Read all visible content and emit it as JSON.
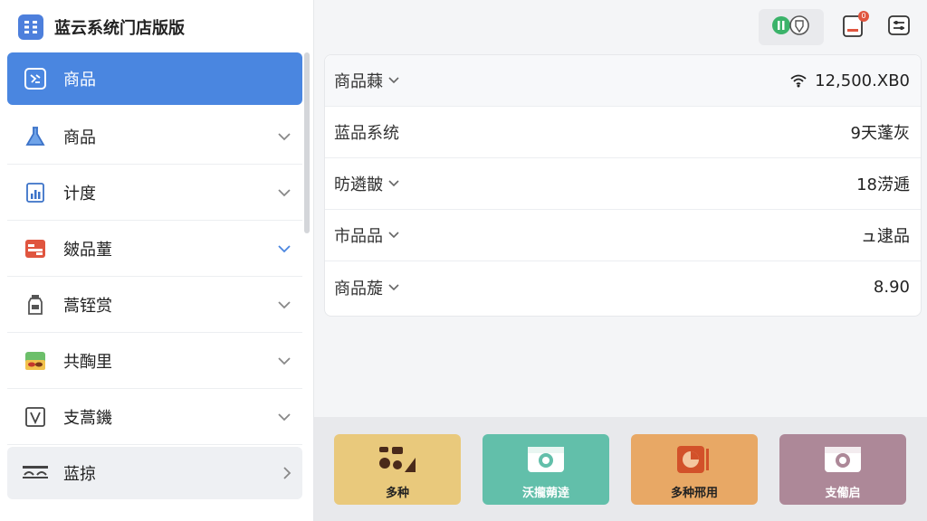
{
  "app": {
    "title": "蓝云系统门店版版"
  },
  "sidebar": {
    "items": [
      {
        "label": "商品",
        "icon": "product-icon",
        "state": "active"
      },
      {
        "label": "商品",
        "icon": "flask-icon"
      },
      {
        "label": "计度",
        "icon": "chart-doc-icon"
      },
      {
        "label": "皴品蕫",
        "icon": "store-card-icon"
      },
      {
        "label": "蒿铚赏",
        "icon": "jar-icon"
      },
      {
        "label": "共醄里",
        "icon": "food-tray-icon"
      },
      {
        "label": "支蒿鐖",
        "icon": "v-box-icon"
      },
      {
        "label": "蓝掠",
        "icon": "scale-icon"
      }
    ]
  },
  "toolbar": {
    "status_icon": "toggle-shield-icon",
    "notify_badge": "0",
    "notify_icon": "notification-card-icon",
    "settings_icon": "sliders-icon"
  },
  "info": {
    "rows": [
      {
        "label": "商品蕀",
        "value": "12,500.XB0",
        "has_caret": true,
        "value_icon": "wifi-icon"
      },
      {
        "label": "蓝品系统",
        "value": "9天蓬灰",
        "has_caret": false
      },
      {
        "label": "昉遴皵",
        "value": "18涝逓",
        "has_caret": true
      },
      {
        "label": "市品品",
        "value": "ュ逮品",
        "has_caret": true
      },
      {
        "label": "商品蔙",
        "value": "8.90",
        "has_caret": true
      }
    ]
  },
  "actions": [
    {
      "label": "多种",
      "icon": "shapes-icon",
      "color": "#e9c97c"
    },
    {
      "label": "沃攏蒴逹",
      "icon": "camera-icon",
      "color": "#62bfaa"
    },
    {
      "label": "多种邢用",
      "icon": "pie-card-icon",
      "color": "#e8a865"
    },
    {
      "label": "支僃启",
      "icon": "camera-icon",
      "color": "#ad8898"
    }
  ]
}
